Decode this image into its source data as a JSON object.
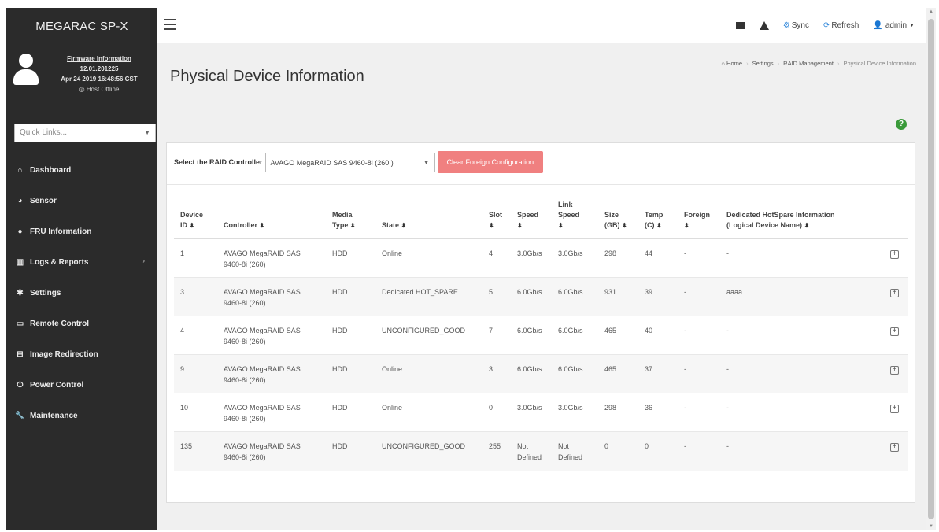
{
  "brand": "MEGARAC SP-X",
  "firmware": {
    "title": "Firmware Information",
    "version": "12.01.201225",
    "date": "Apr 24 2019 16:48:56 CST",
    "host_status": "Host Offline"
  },
  "quick_links": {
    "placeholder": "Quick Links..."
  },
  "nav": [
    {
      "label": "Dashboard",
      "icon": "home-icon"
    },
    {
      "label": "Sensor",
      "icon": "gauge-icon"
    },
    {
      "label": "FRU Information",
      "icon": "info-icon"
    },
    {
      "label": "Logs & Reports",
      "icon": "chart-icon"
    },
    {
      "label": "Settings",
      "icon": "gear-icon"
    },
    {
      "label": "Remote Control",
      "icon": "monitor-icon"
    },
    {
      "label": "Image Redirection",
      "icon": "disc-icon"
    },
    {
      "label": "Power Control",
      "icon": "power-icon"
    },
    {
      "label": "Maintenance",
      "icon": "wrench-icon"
    }
  ],
  "topbar": {
    "sync": "Sync",
    "refresh": "Refresh",
    "user": "admin"
  },
  "page": {
    "title": "Physical Device Information"
  },
  "breadcrumb": [
    "Home",
    "Settings",
    "RAID Management",
    "Physical Device Information"
  ],
  "controller": {
    "label": "Select the RAID Controller",
    "selected": "AVAGO MegaRAID SAS 9460-8i (260 )",
    "clear_button": "Clear Foreign Configuration"
  },
  "table": {
    "headers": {
      "device_id_1": "Device",
      "device_id_2": "ID",
      "controller": "Controller",
      "media_1": "Media",
      "media_2": "Type",
      "state": "State",
      "slot": "Slot",
      "speed": "Speed",
      "link_1": "Link",
      "link_2": "Speed",
      "size_1": "Size",
      "size_2": "(GB)",
      "temp_1": "Temp",
      "temp_2": "(C)",
      "foreign": "Foreign",
      "hotspare_1": "Dedicated HotSpare Information",
      "hotspare_2": "(Logical Device Name)"
    },
    "rows": [
      {
        "id": "1",
        "ctrl_1": "AVAGO MegaRAID SAS",
        "ctrl_2": "9460-8i (260)",
        "media": "HDD",
        "state": "Online",
        "slot": "4",
        "speed_1": "3.0Gb/s",
        "speed_2": "",
        "link_1": "3.0Gb/s",
        "link_2": "",
        "size": "298",
        "temp": "44",
        "foreign": "-",
        "hotspare": "-"
      },
      {
        "id": "3",
        "ctrl_1": "AVAGO MegaRAID SAS",
        "ctrl_2": "9460-8i (260)",
        "media": "HDD",
        "state": "Dedicated HOT_SPARE",
        "slot": "5",
        "speed_1": "6.0Gb/s",
        "speed_2": "",
        "link_1": "6.0Gb/s",
        "link_2": "",
        "size": "931",
        "temp": "39",
        "foreign": "-",
        "hotspare": "aaaa"
      },
      {
        "id": "4",
        "ctrl_1": "AVAGO MegaRAID SAS",
        "ctrl_2": "9460-8i (260)",
        "media": "HDD",
        "state": "UNCONFIGURED_GOOD",
        "slot": "7",
        "speed_1": "6.0Gb/s",
        "speed_2": "",
        "link_1": "6.0Gb/s",
        "link_2": "",
        "size": "465",
        "temp": "40",
        "foreign": "-",
        "hotspare": "-"
      },
      {
        "id": "9",
        "ctrl_1": "AVAGO MegaRAID SAS",
        "ctrl_2": "9460-8i (260)",
        "media": "HDD",
        "state": "Online",
        "slot": "3",
        "speed_1": "6.0Gb/s",
        "speed_2": "",
        "link_1": "6.0Gb/s",
        "link_2": "",
        "size": "465",
        "temp": "37",
        "foreign": "-",
        "hotspare": "-"
      },
      {
        "id": "10",
        "ctrl_1": "AVAGO MegaRAID SAS",
        "ctrl_2": "9460-8i (260)",
        "media": "HDD",
        "state": "Online",
        "slot": "0",
        "speed_1": "3.0Gb/s",
        "speed_2": "",
        "link_1": "3.0Gb/s",
        "link_2": "",
        "size": "298",
        "temp": "36",
        "foreign": "-",
        "hotspare": "-"
      },
      {
        "id": "135",
        "ctrl_1": "AVAGO MegaRAID SAS",
        "ctrl_2": "9460-8i (260)",
        "media": "HDD",
        "state": "UNCONFIGURED_GOOD",
        "slot": "255",
        "speed_1": "Not",
        "speed_2": "Defined",
        "link_1": "Not",
        "link_2": "Defined",
        "size": "0",
        "temp": "0",
        "foreign": "-",
        "hotspare": "-"
      }
    ]
  },
  "colors": {
    "sidebar": "#2b2b2b",
    "accent": "#3a8ddc",
    "danger_button": "#f08080",
    "help": "#3a9a3a"
  }
}
